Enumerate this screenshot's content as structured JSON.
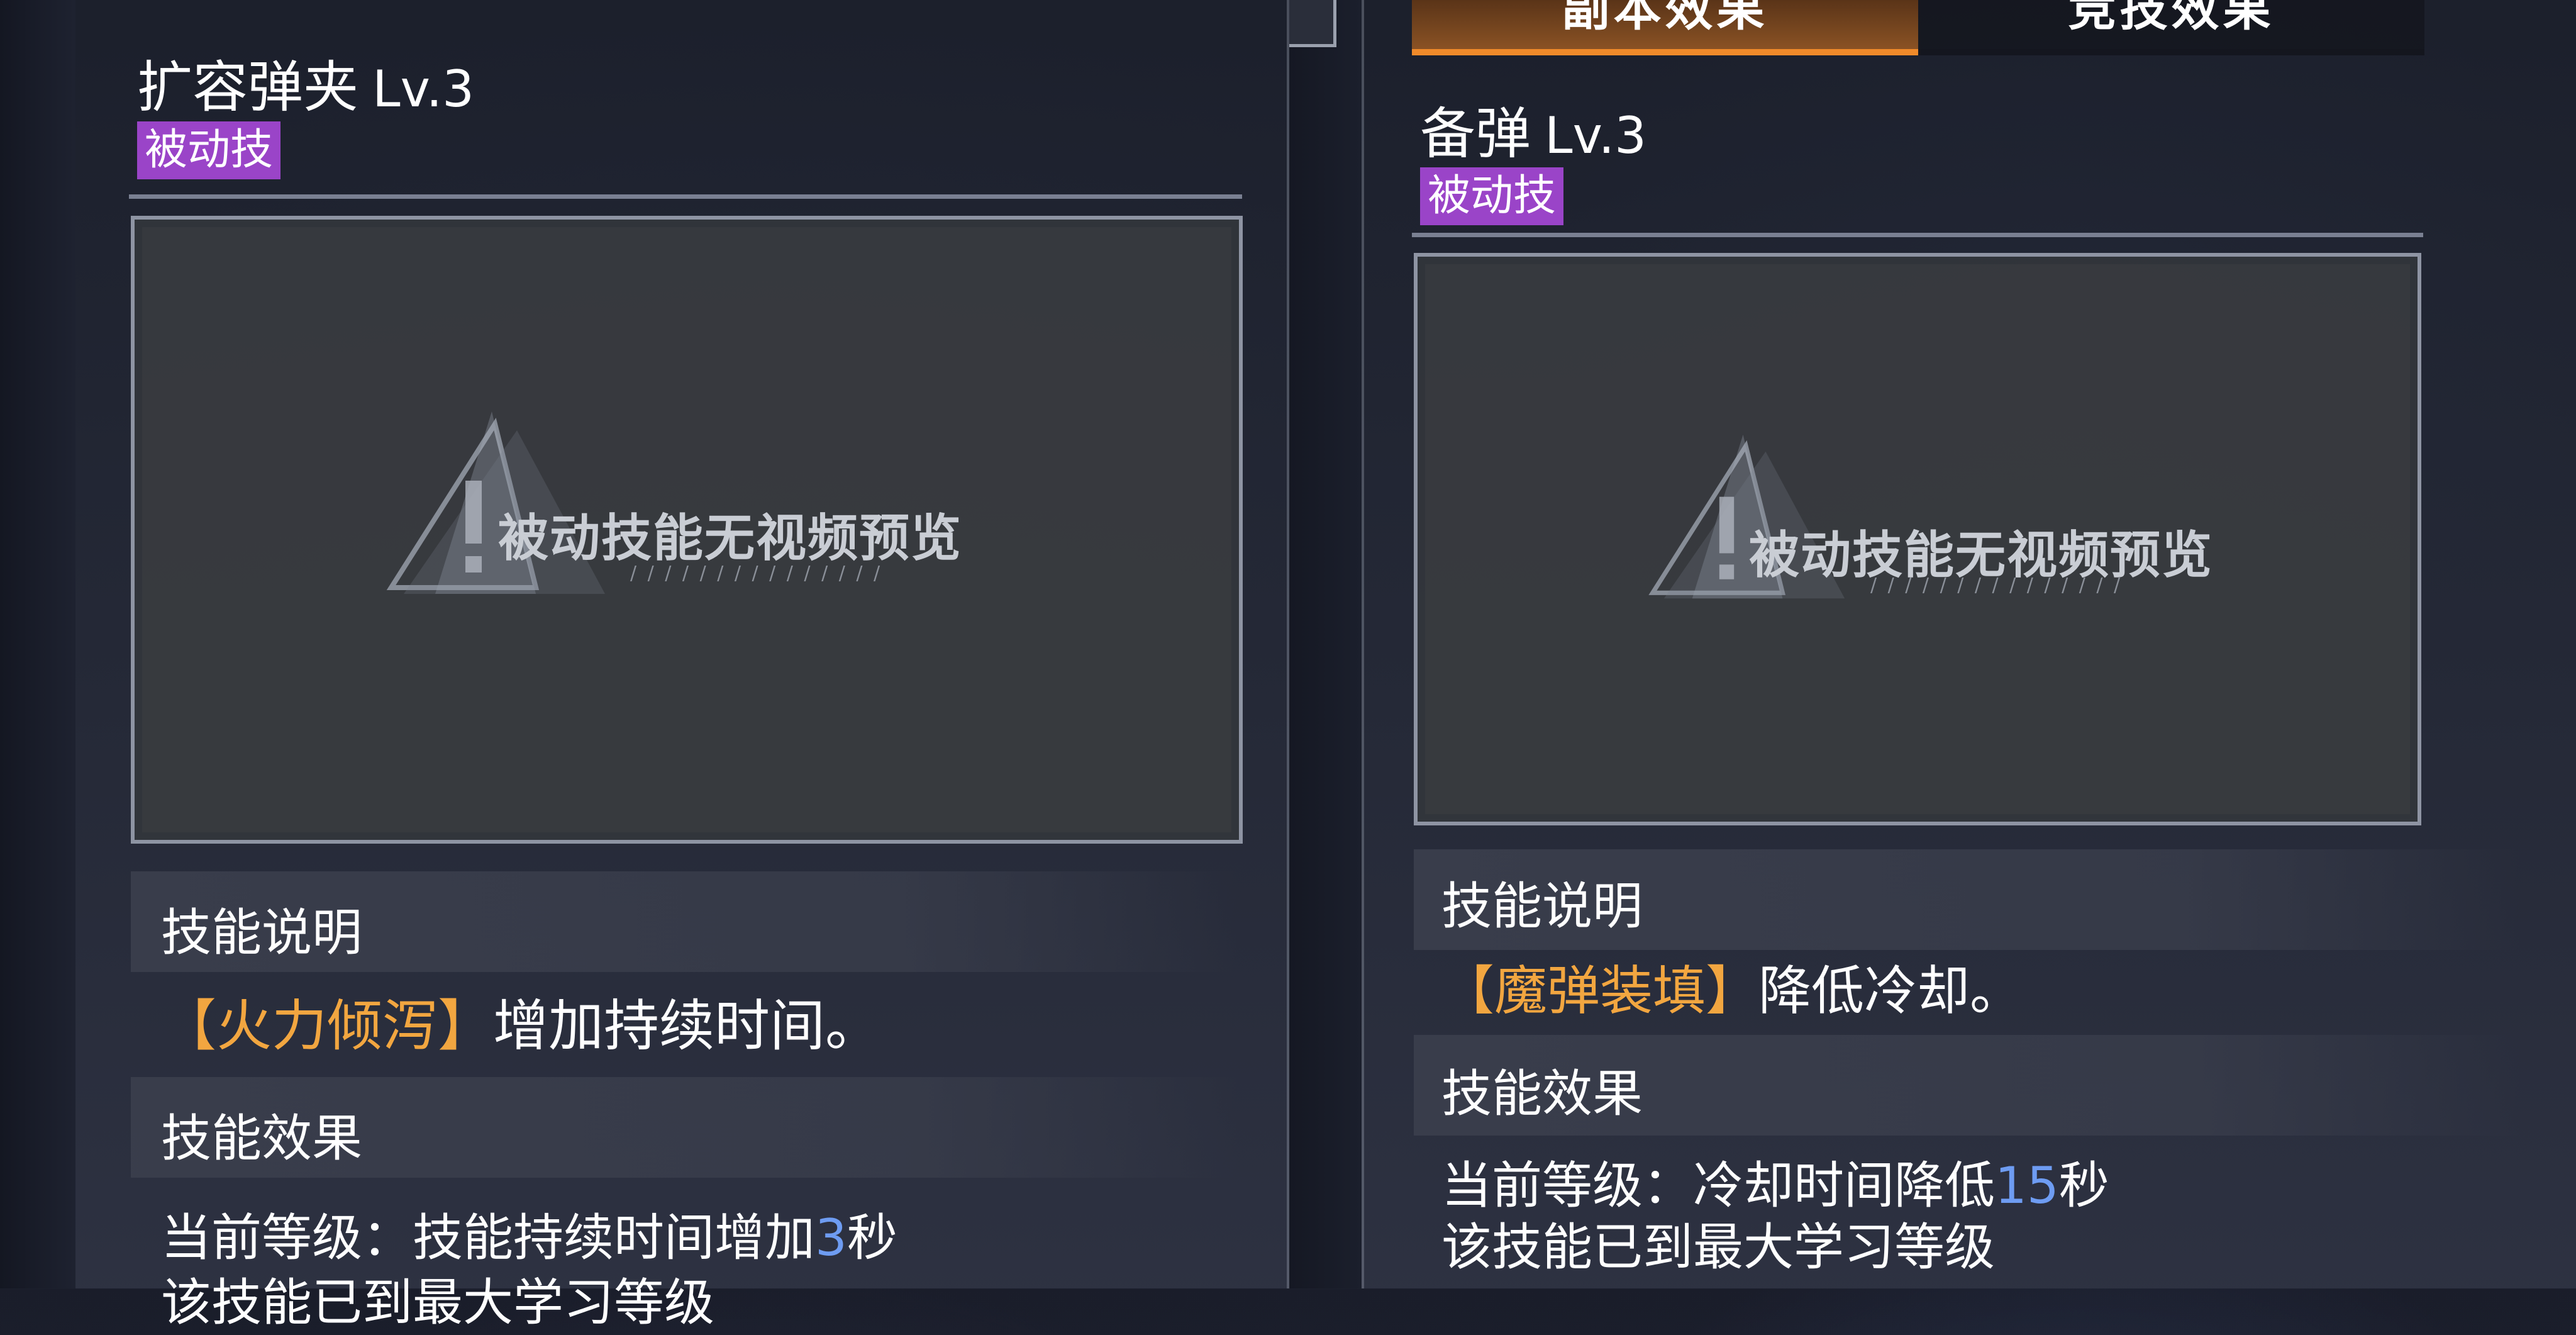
{
  "tabs": {
    "dungeon_label": "副本效果",
    "arena_label": "竞技效果"
  },
  "left": {
    "skill_name": "扩容弹夹",
    "level": "Lv.3",
    "tag": "被动技",
    "video_placeholder": "被动技能无视频预览",
    "description_header": "技能说明",
    "description": {
      "bracket_open": "【",
      "keyword": "火力倾泻",
      "bracket_close": "】",
      "text": "增加持续时间。"
    },
    "effect_header": "技能效果",
    "effect_current_prefix": "当前等级：技能持续时间增加",
    "effect_current_value": "3",
    "effect_current_suffix": "秒",
    "effect_max": "该技能已到最大学习等级"
  },
  "right": {
    "skill_name": "备弹",
    "level": "Lv.3",
    "tag": "被动技",
    "video_placeholder": "被动技能无视频预览",
    "description_header": "技能说明",
    "description": {
      "bracket_open": "【",
      "keyword": "魔弹装填",
      "bracket_close": "】",
      "text": "降低冷却。"
    },
    "effect_header": "技能效果",
    "effect_current_prefix": "当前等级：冷却时间降低",
    "effect_current_value": "15",
    "effect_current_suffix": "秒",
    "effect_max": "该技能已到最大学习等级"
  },
  "colors": {
    "accent_orange": "#f08a2a",
    "keyword_orange": "#f2a640",
    "tag_purple": "#9a44c8",
    "value_blue": "#6e9cf2"
  },
  "icons": {
    "preview": "warning-triangle-icon"
  }
}
